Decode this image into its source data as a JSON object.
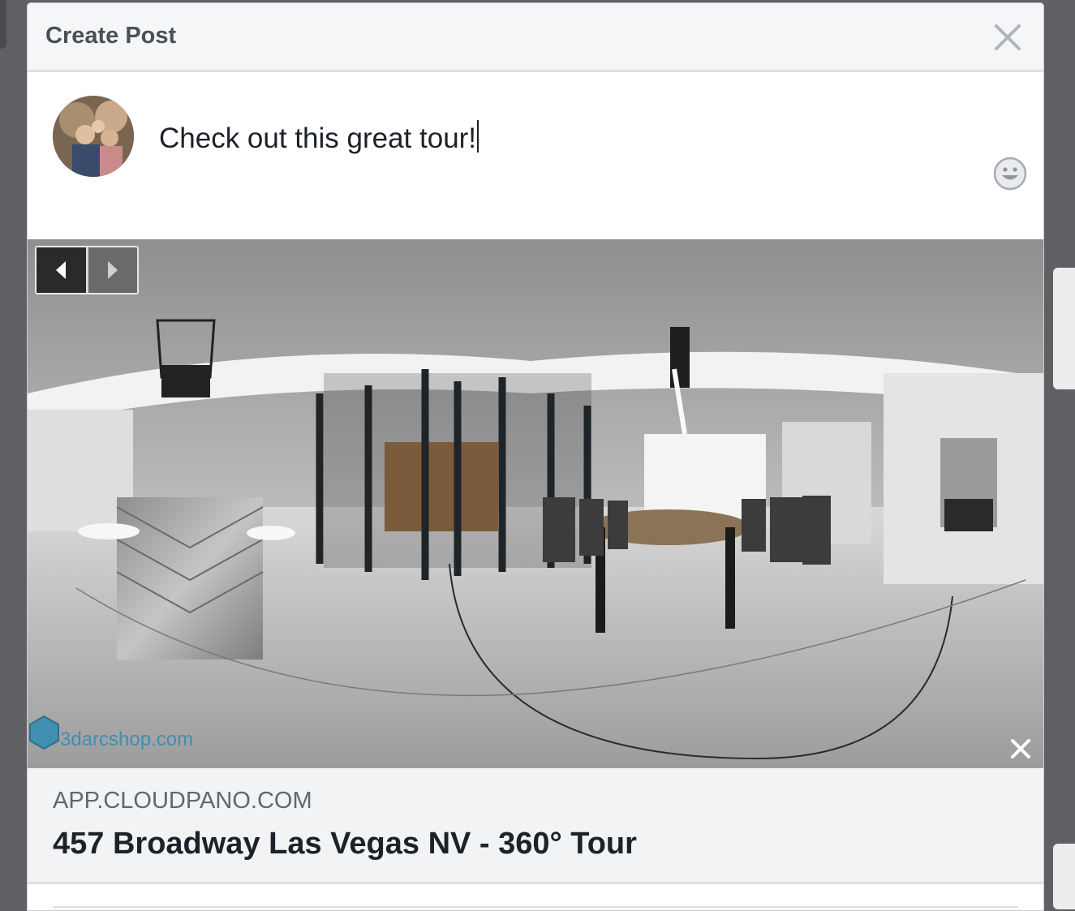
{
  "dialog": {
    "title": "Create Post",
    "close_icon": "close-icon"
  },
  "composer": {
    "text": "Check out this great tour!",
    "avatar_alt": "profile photo",
    "emoji_icon": "emoji-icon"
  },
  "preview": {
    "watermark": "3darcshop.com",
    "prev_icon": "chevron-left-icon",
    "next_icon": "chevron-right-icon",
    "remove_icon": "close-icon"
  },
  "link": {
    "domain": "APP.CLOUDPANO.COM",
    "title": "457 Broadway Las Vegas NV - 360° Tour"
  },
  "colors": {
    "header_bg": "#f5f6f7",
    "title_text": "#4b4f56",
    "link_bg": "#f2f3f5",
    "domain_text": "#606770"
  }
}
